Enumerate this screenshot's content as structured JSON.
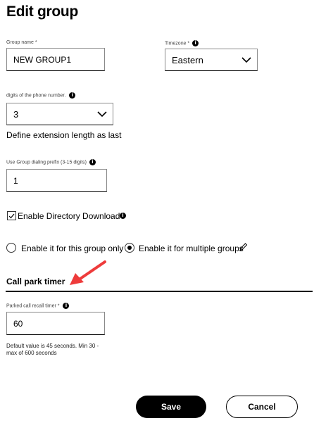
{
  "page": {
    "title": "Edit group"
  },
  "group_name": {
    "label": "Group name *",
    "value": "NEW GROUP1"
  },
  "timezone": {
    "label": "Timezone *",
    "value": "Eastern"
  },
  "extension": {
    "label": "digits of the phone number.",
    "value": "3",
    "description": "Define extension length as last"
  },
  "dialing_prefix": {
    "label": "Use Group dialing prefix (3-15 digits)",
    "value": "1"
  },
  "directory": {
    "label": "Enable Directory Download",
    "checked": true
  },
  "scope": {
    "option_single": "Enable it for this group only",
    "option_multiple": "Enable it for multiple groups",
    "selected": "multiple"
  },
  "call_park": {
    "heading": "Call park timer",
    "label": "Parked call recall timer *",
    "value": "60",
    "hint_line1": "Default value is 45 seconds. Min 30 -",
    "hint_line2": "max of 600 seconds"
  },
  "actions": {
    "save": "Save",
    "cancel": "Cancel"
  },
  "colors": {
    "annotation_arrow": "#ee3b3b",
    "primary_button": "#000000"
  },
  "icons": {
    "info": "info-icon",
    "chevron": "chevron-down-icon",
    "check": "checkmark-icon",
    "edit": "pencil-icon",
    "annotation": "red-arrow-icon"
  }
}
